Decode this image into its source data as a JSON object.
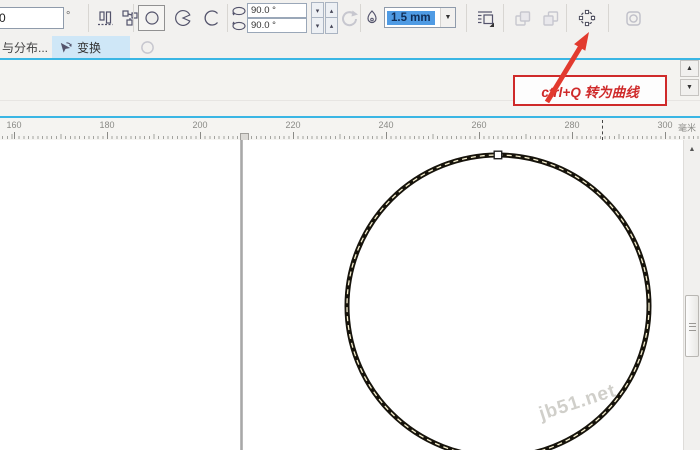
{
  "property_bar": {
    "rotation_input": "0",
    "rotation_unit": "°",
    "start_angle": "90.0 °",
    "end_angle": "90.0 °",
    "outline_width": "1.5 mm"
  },
  "docker_tabs": {
    "left_tab": "与分布...",
    "transform_tab": "变换"
  },
  "annotation": {
    "text": "ctrl+Q 转为曲线"
  },
  "ruler": {
    "labels": [
      "160",
      "180",
      "200",
      "220",
      "240",
      "260",
      "280",
      "300"
    ],
    "unit": "毫米"
  },
  "watermark": "jb51.net",
  "glyphs": {
    "spin_down": "▾",
    "spin_up": "▴",
    "dropdown_arrow": "▼",
    "scroll_up": "▲",
    "triangle_up": "▲",
    "triangle_down": "▼"
  },
  "colors": {
    "accent_cyan": "#3ab6e4",
    "selection_blue": "#4f9be4",
    "annotation_red": "#cf2a2a",
    "circle_stroke": "#16130b"
  },
  "icons": [
    "align-icon",
    "distribute-icon",
    "ellipse-icon",
    "pie-icon",
    "arc-icon",
    "start-angle-icon",
    "end-angle-icon",
    "rotate-icon",
    "outline-pen-icon",
    "wrap-text-icon",
    "order-front-icon",
    "order-back-icon",
    "convert-to-curves-icon",
    "frame-icon",
    "transform-icon",
    "circle-icon"
  ]
}
